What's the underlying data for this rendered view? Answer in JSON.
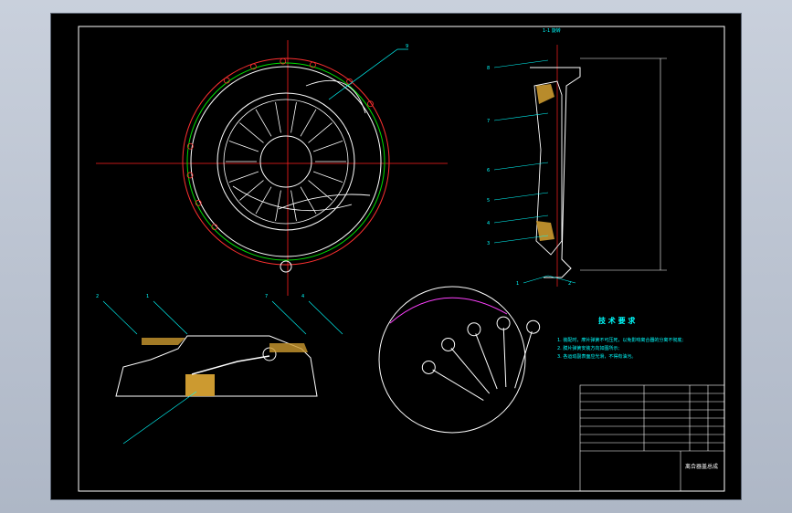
{
  "section_label": "1-1 旋转",
  "tech_title": "技 术 要 求",
  "tech_notes": [
    "1. 装配时，摩片弹簧不可压死，以免影响离合器的分离不彻底;",
    "2. 膜片弹簧安装方向如图所示;",
    "3. 各运动副表面应光滑，不得有油污。"
  ],
  "drawing_title": "离合器盖总成",
  "callouts_side": [
    "8",
    "7",
    "6",
    "5",
    "4",
    "3",
    "2",
    "1"
  ],
  "callouts_section": [
    "2",
    "1",
    "7",
    "4"
  ],
  "callouts_top": [
    "9"
  ],
  "colors": {
    "outline": "#ffffff",
    "center": "#ff2020",
    "leader": "#00ffff",
    "pressure_plate": "#ff40ff",
    "ring_green": "#00e000",
    "hatch": "#ffff00"
  }
}
